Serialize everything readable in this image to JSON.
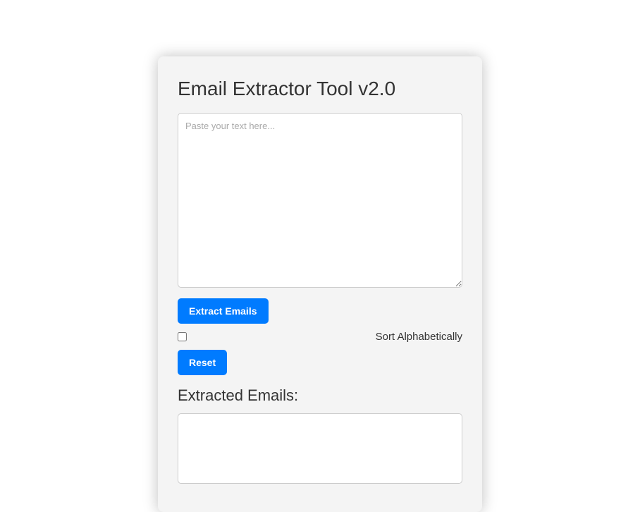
{
  "title": "Email Extractor Tool v2.0",
  "input_placeholder": "Paste your text here...",
  "buttons": {
    "extract": "Extract Emails",
    "reset": "Reset"
  },
  "sort_label": "Sort Alphabetically",
  "output_heading": "Extracted Emails:",
  "output_value": ""
}
